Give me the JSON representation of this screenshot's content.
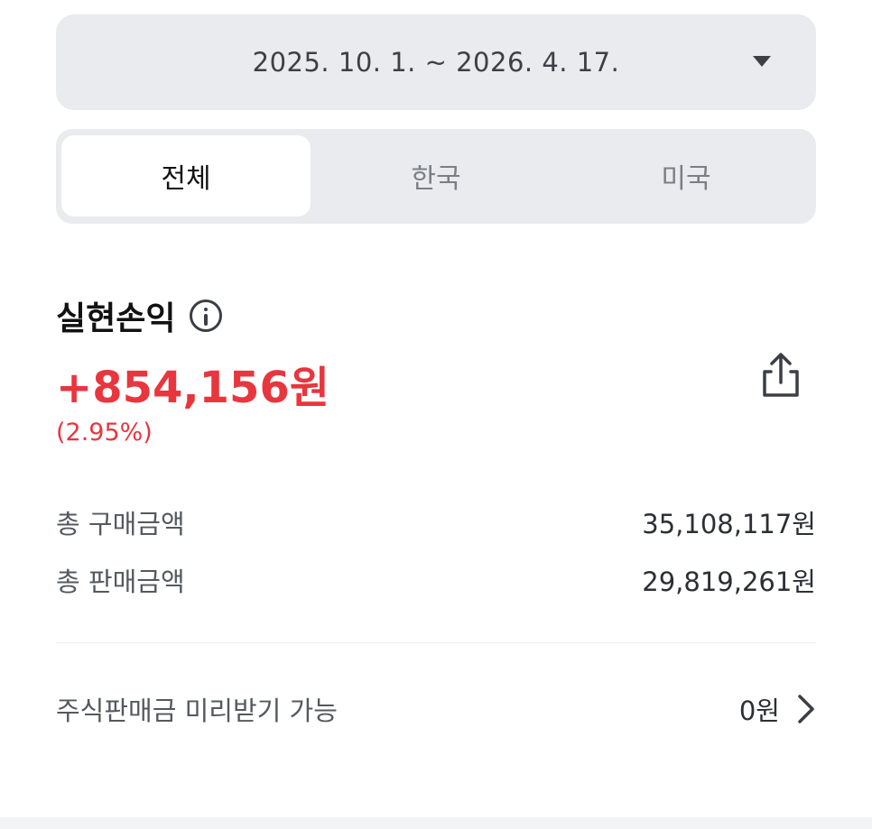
{
  "date_range": {
    "label": "2025. 10. 1. ~ 2026. 4. 17.",
    "dropdown_icon": "caret-down-icon"
  },
  "market_tabs": [
    {
      "label": "전체",
      "selected": true
    },
    {
      "label": "한국",
      "selected": false
    },
    {
      "label": "미국",
      "selected": false
    }
  ],
  "realized_pl": {
    "title": "실현손익",
    "info_icon": "info-icon",
    "amount": "+854,156원",
    "rate": "(2.95%)",
    "share_icon": "share-icon"
  },
  "summary": [
    {
      "label": "총 구매금액",
      "value": "35,108,117원"
    },
    {
      "label": "총 판매금액",
      "value": "29,819,261원"
    }
  ],
  "advance": {
    "label": "주식판매금 미리받기 가능",
    "value": "0원",
    "chevron_icon": "chevron-right-icon"
  },
  "colors": {
    "accent_red": "#e8363e",
    "panel_gray": "#e9ebee",
    "text_dark": "#111111",
    "text_muted": "#54595f"
  }
}
